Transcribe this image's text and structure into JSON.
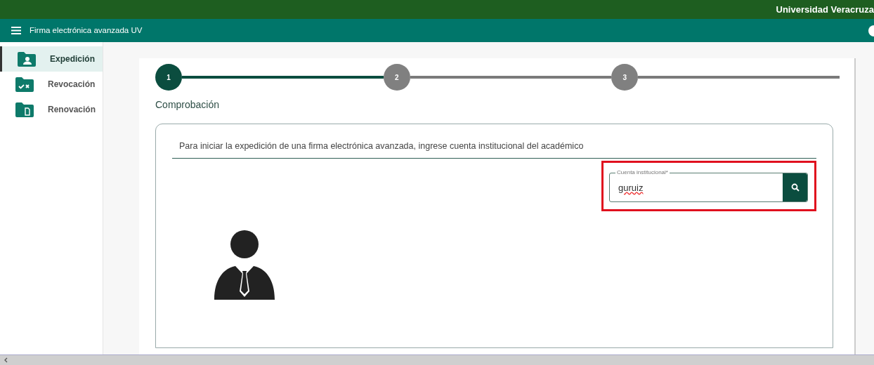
{
  "top_bar": {
    "org": "Universidad Veracruza"
  },
  "app_bar": {
    "title": "Firma electrónica avanzada UV"
  },
  "sidebar": {
    "items": [
      {
        "label": "Expedición",
        "kind": "person",
        "selected": true
      },
      {
        "label": "Revocación",
        "kind": "revoke",
        "selected": false
      },
      {
        "label": "Renovación",
        "kind": "document",
        "selected": false
      }
    ]
  },
  "stepper": {
    "steps": [
      {
        "number": "1",
        "selected": true
      },
      {
        "number": "2",
        "selected": false
      },
      {
        "number": "3",
        "selected": false
      }
    ]
  },
  "section_title": "Comprobación",
  "instruction": "Para iniciar la expedición de una firma electrónica avanzada, ingrese cuenta institucional del académico",
  "account_field": {
    "label": "Cuenta institucional*",
    "value": "guruiz",
    "highlighted": true
  }
}
